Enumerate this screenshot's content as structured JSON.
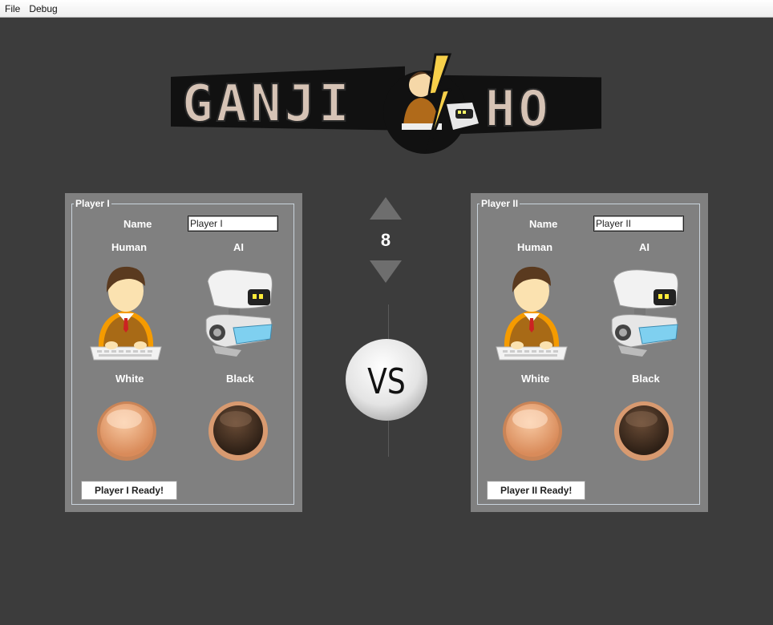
{
  "menu": {
    "file": "File",
    "debug": "Debug"
  },
  "logo": {
    "text_left": "GANJI",
    "text_right": "HO",
    "alt_name": "Ganji-Ho logo"
  },
  "counter": {
    "value": "8"
  },
  "vs_label": "VS",
  "players": [
    {
      "legend": "Player I",
      "name_label": "Name",
      "name_value": "Player I",
      "human_label": "Human",
      "ai_label": "AI",
      "white_label": "White",
      "black_label": "Black",
      "ready_label": "Player I Ready!"
    },
    {
      "legend": "Player II",
      "name_label": "Name",
      "name_value": "Player II",
      "human_label": "Human",
      "ai_label": "AI",
      "white_label": "White",
      "black_label": "Black",
      "ready_label": "Player II Ready!"
    }
  ],
  "colors": {
    "background": "#3c3c3c",
    "panel": "#808080",
    "white_stone": "#e4a27a",
    "black_stone": "#4a3526",
    "stone_rim": "#d89a70"
  }
}
